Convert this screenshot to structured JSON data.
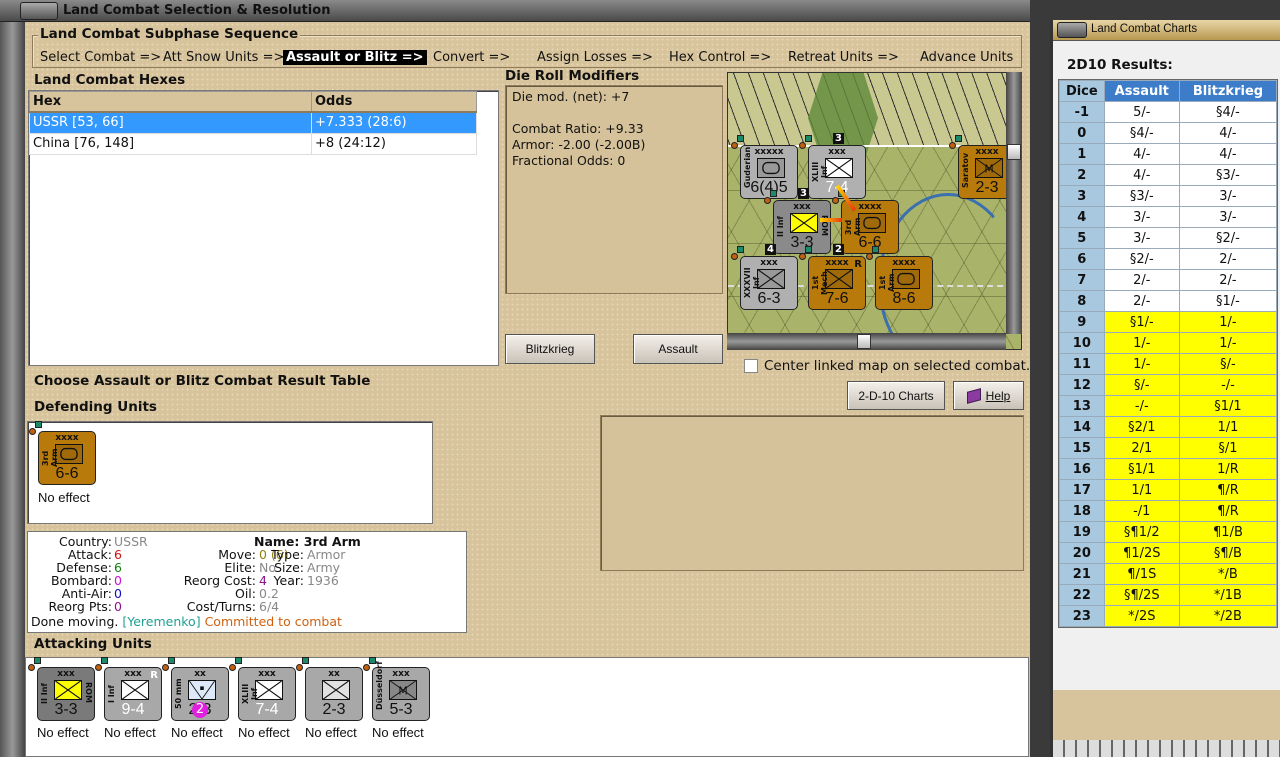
{
  "window": {
    "title": "Land Combat Selection & Resolution"
  },
  "sequence": {
    "title": "Land Combat Subphase Sequence",
    "steps": [
      {
        "label": "Select Combat =>",
        "active": false
      },
      {
        "label": "Att Snow Units =>",
        "active": false
      },
      {
        "label": "Assault or Blitz =>",
        "active": true
      },
      {
        "label": "Convert =>",
        "active": false
      },
      {
        "label": "Assign Losses =>",
        "active": false
      },
      {
        "label": "Hex Control =>",
        "active": false
      },
      {
        "label": "Retreat Units =>",
        "active": false
      },
      {
        "label": "Advance Units",
        "active": false
      }
    ]
  },
  "hexes": {
    "title": "Land Combat Hexes",
    "columns": [
      "Hex",
      "Odds"
    ],
    "rows": [
      [
        "USSR [53, 66]",
        "+7.333 (28:6)"
      ],
      [
        "China [76, 148]",
        "+8 (24:12)"
      ]
    ],
    "selected_index": 0
  },
  "modifiers": {
    "title": "Die Roll Modifiers",
    "lines": [
      "Die mod. (net): +7",
      "",
      "Combat Ratio: +9.33",
      "Armor: -2.00 (-2.00B)",
      "Fractional Odds: 0"
    ]
  },
  "buttons": {
    "blitzkrieg": "Blitzkrieg",
    "assault": "Assault",
    "charts": "2-D-10 Charts",
    "help": "Help"
  },
  "center_map": {
    "label": "Center linked map on selected combat.",
    "checked": false
  },
  "choose_label": "Choose Assault or Blitz Combat Result Table",
  "defending": {
    "title": "Defending Units",
    "units": [
      {
        "name": "3rd Arm",
        "size": "xxxx",
        "stats": "6-6",
        "bg": "#b87a0a",
        "sym": "armor",
        "result": "No effect"
      }
    ]
  },
  "unit_info": {
    "country_k": "Country:",
    "country": "USSR",
    "attack_k": "Attack:",
    "attack": "6",
    "defense_k": "Defense:",
    "defense": "6",
    "bombard_k": "Bombard:",
    "bombard": "0",
    "antiair_k": "Anti-Air:",
    "antiair": "0",
    "reorgpts_k": "Reorg Pts:",
    "reorgpts": "0",
    "move_k": "Move:",
    "move": "0 (6)",
    "elite_k": "Elite:",
    "elite": "No",
    "reorgcost_k": "Reorg Cost:",
    "reorgcost": "4",
    "oil_k": "Oil:",
    "oil": "0.2",
    "costturns_k": "Cost/Turns:",
    "costturns": "6/4",
    "name_k": "Name:",
    "name": "3rd Arm",
    "type_k": "Type:",
    "type": "Armor",
    "size_k": "Size:",
    "size": "Army",
    "year_k": "Year:",
    "year": "1936",
    "status": "Done moving.",
    "leader": "[Yeremenko]",
    "combat": "Committed to combat"
  },
  "attacking": {
    "title": "Attacking Units",
    "units": [
      {
        "name": "II Inf",
        "size": "xxx",
        "stats": "3-3",
        "bg": "#7a7a7a",
        "symfill": "#ffff00",
        "sym": "inf",
        "side": "ROM",
        "result": "No effect",
        "stcolor": "#111"
      },
      {
        "name": "I Inf",
        "size": "xxx",
        "stats": "9-4",
        "bg": "#a8a8a8",
        "symfill": "#fff",
        "sym": "inf",
        "tag": "R",
        "result": "No effect",
        "stcolor": "#fff"
      },
      {
        "name": "50 mm",
        "size": "xx",
        "stats": "2-3",
        "bg": "#a8a8a8",
        "symfill": "#dde8f8",
        "sym": "aa",
        "badge": "2",
        "result": "No effect",
        "stcolor": "#111"
      },
      {
        "name": "XLIII Inf",
        "size": "xxx",
        "stats": "7-4",
        "bg": "#a8a8a8",
        "symfill": "#fff",
        "sym": "inf",
        "result": "No effect",
        "stcolor": "#fff"
      },
      {
        "name": "",
        "size": "xx",
        "stats": "2-3",
        "bg": "#a8a8a8",
        "symfill": "#e0e0e0",
        "sym": "inf",
        "result": "No effect",
        "stcolor": "#111"
      },
      {
        "name": "Düsseldorf",
        "size": "xxx",
        "stats": "5-3",
        "bg": "#a8a8a8",
        "symfill": "#888",
        "sym": "mtn",
        "result": "No effect",
        "stcolor": "#111"
      }
    ]
  },
  "map_counters": [
    {
      "name": "Guderian",
      "size": "xxxxx",
      "stats": "6(4)5",
      "bg": "#b0b0b0",
      "symfill": "#999",
      "sym": "armor"
    },
    {
      "name": "XLIII Inf",
      "size": "xxx",
      "stats": "7-4",
      "bg": "#b0b0b0",
      "symfill": "#fff",
      "sym": "inf",
      "stack": "3",
      "stcolor": "#fff"
    },
    {
      "name": "Saratov",
      "size": "xxxx",
      "stats": "2-3",
      "bg": "#b87a0a",
      "symfill": "#a06a0a",
      "sym": "mtn"
    },
    {
      "name": "II Inf",
      "size": "xxx",
      "stats": "3-3",
      "bg": "#8a8a8a",
      "symfill": "#ffff00",
      "sym": "inf",
      "side": "ROM",
      "stack": "3"
    },
    {
      "name": "3rd Arm",
      "size": "xxxx",
      "stats": "6-6",
      "bg": "#b87a0a",
      "symfill": "#a06a0a",
      "sym": "armor"
    },
    {
      "name": "XXXVII Inf",
      "size": "xxx",
      "stats": "6-3",
      "bg": "#b0b0b0",
      "symfill": "#999",
      "sym": "inf",
      "stack": "4"
    },
    {
      "name": "1st Mech",
      "size": "xxxx",
      "stats": "7-6",
      "bg": "#b87a0a",
      "symfill": "#a06a0a",
      "sym": "inf",
      "tag": "R",
      "stack": "2"
    },
    {
      "name": "1st Arm",
      "size": "xxxx",
      "stats": "8-6",
      "bg": "#b87a0a",
      "symfill": "#a06a0a",
      "sym": "armor"
    }
  ],
  "charts": {
    "window_title": "Land Combat Charts",
    "title": "2D10 Results:",
    "columns": [
      "Dice",
      "Assault",
      "Blitzkrieg"
    ],
    "highlight_color": "#ffff00",
    "rows": [
      [
        "-1",
        "5/-",
        "§4/-"
      ],
      [
        "0",
        "§4/-",
        "4/-"
      ],
      [
        "1",
        "4/-",
        "4/-"
      ],
      [
        "2",
        "4/-",
        "§3/-"
      ],
      [
        "3",
        "§3/-",
        "3/-"
      ],
      [
        "4",
        "3/-",
        "3/-"
      ],
      [
        "5",
        "3/-",
        "§2/-"
      ],
      [
        "6",
        "§2/-",
        "2/-"
      ],
      [
        "7",
        "2/-",
        "2/-"
      ],
      [
        "8",
        "2/-",
        "§1/-"
      ],
      [
        "9",
        "§1/-",
        "1/-"
      ],
      [
        "10",
        "1/-",
        "1/-"
      ],
      [
        "11",
        "1/-",
        "§/-"
      ],
      [
        "12",
        "§/-",
        "-/-"
      ],
      [
        "13",
        "-/-",
        "§1/1"
      ],
      [
        "14",
        "§2/1",
        "1/1"
      ],
      [
        "15",
        "2/1",
        "§/1"
      ],
      [
        "16",
        "§1/1",
        "1/R"
      ],
      [
        "17",
        "1/1",
        "¶/R"
      ],
      [
        "18",
        "-/1",
        "¶/R"
      ],
      [
        "19",
        "§¶1/2",
        "¶1/B"
      ],
      [
        "20",
        "¶1/2S",
        "§¶/B"
      ],
      [
        "21",
        "¶/1S",
        "*/B"
      ],
      [
        "22",
        "§¶/2S",
        "*/1B"
      ],
      [
        "23",
        "*/2S",
        "*/2B"
      ]
    ],
    "highlight_from_dice": "9"
  }
}
